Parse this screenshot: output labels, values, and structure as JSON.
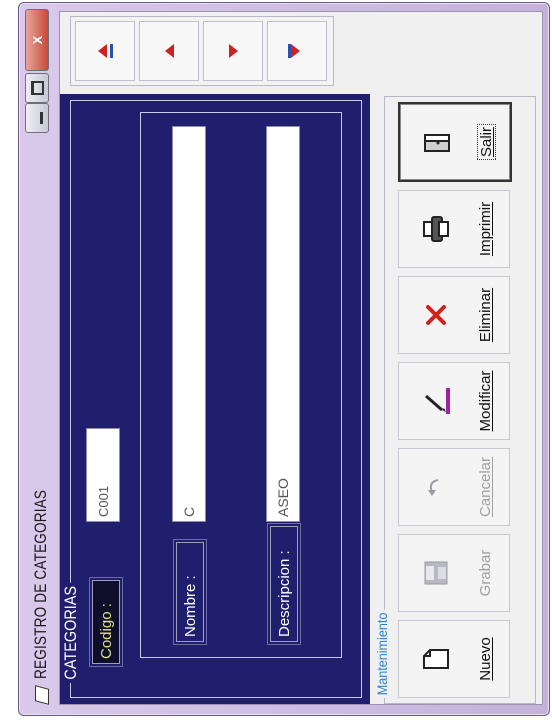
{
  "window": {
    "title": "REGISTRO DE CATEGORIAS",
    "controls": {
      "close": "X"
    }
  },
  "categorias": {
    "legend": "CATEGORIAS",
    "codigo": {
      "label": "Codigo  :",
      "value": "C001"
    },
    "nombre": {
      "label": "Nombre  :",
      "value": "C"
    },
    "descripcion": {
      "label": "Descripcion :",
      "value": "ASEO"
    }
  },
  "navigation": {
    "buttons": [
      "first-icon",
      "previous-icon",
      "next-icon",
      "last-icon"
    ],
    "arrow_color": "#cc2222",
    "edge_color": "#2b4fb0"
  },
  "mantenimiento": {
    "legend": "Mantenimiento",
    "buttons": {
      "nuevo": "Nuevo",
      "grabar": "Grabar",
      "cancelar": "Cancelar",
      "modificar": "Modificar",
      "eliminar": "Eliminar",
      "imprimir": "Imprimir",
      "salir": "Salir"
    }
  },
  "colors": {
    "panel_bg": "#1f1f6e",
    "mantenimiento_legend": "#2b82d6",
    "title_bar": "#c5b2dc"
  }
}
